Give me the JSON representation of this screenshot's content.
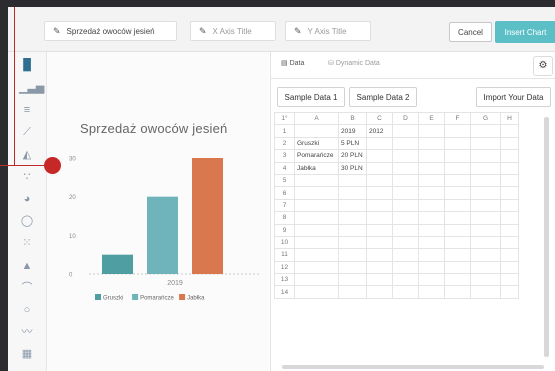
{
  "toolbar": {
    "chart_title_value": "Sprzedaż owoców jesień",
    "x_axis_placeholder": "X Axis Title",
    "y_axis_placeholder": "Y Axis Title",
    "cancel_label": "Cancel",
    "insert_label": "Insert Chart"
  },
  "rail": {
    "icons": [
      "bar-chart-icon",
      "column-chart-icon",
      "stacked-bar-icon",
      "line-chart-icon",
      "area-chart-icon",
      "scatter-icon",
      "pie-chart-icon",
      "donut-chart-icon",
      "heatmap-icon",
      "mountain-icon",
      "arc-icon",
      "circle-icon",
      "sparkline-icon",
      "table-icon"
    ]
  },
  "panel": {
    "tab_data": "Data",
    "tab_dynamic": "Dynamic Data",
    "sample1": "Sample Data 1",
    "sample2": "Sample Data 2",
    "import": "Import Your Data"
  },
  "sheet": {
    "corner": "1°",
    "columns": [
      "A",
      "B",
      "C",
      "D",
      "E",
      "F",
      "G",
      "H"
    ],
    "rows": [
      [
        "1",
        "",
        "2019",
        "2012",
        "",
        "",
        "",
        "",
        ""
      ],
      [
        "2",
        "Gruszki",
        "5 PLN",
        "",
        "",
        "",
        "",
        "",
        ""
      ],
      [
        "3",
        "Pomarańcze",
        "20 PLN",
        "",
        "",
        "",
        "",
        "",
        ""
      ],
      [
        "4",
        "Jabłka",
        "30 PLN",
        "",
        "",
        "",
        "",
        "",
        ""
      ],
      [
        "5",
        "",
        "",
        "",
        "",
        "",
        "",
        "",
        ""
      ],
      [
        "6",
        "",
        "",
        "",
        "",
        "",
        "",
        "",
        ""
      ],
      [
        "7",
        "",
        "",
        "",
        "",
        "",
        "",
        "",
        ""
      ],
      [
        "8",
        "",
        "",
        "",
        "",
        "",
        "",
        "",
        ""
      ],
      [
        "9",
        "",
        "",
        "",
        "",
        "",
        "",
        "",
        ""
      ],
      [
        "10",
        "",
        "",
        "",
        "",
        "",
        "",
        "",
        ""
      ],
      [
        "11",
        "",
        "",
        "",
        "",
        "",
        "",
        "",
        ""
      ],
      [
        "12",
        "",
        "",
        "",
        "",
        "",
        "",
        "",
        ""
      ],
      [
        "13",
        "",
        "",
        "",
        "",
        "",
        "",
        "",
        ""
      ],
      [
        "14",
        "",
        "",
        "",
        "",
        "",
        "",
        "",
        ""
      ]
    ]
  },
  "colors": {
    "gruszki": "#4e9ea2",
    "pomarancze": "#6fb4bb",
    "jablka": "#d9774f",
    "accent": "#5cbfc6",
    "callout": "#c62828"
  },
  "chart_data": {
    "type": "bar",
    "title": "Sprzedaż owoców jesień",
    "categories": [
      "2019"
    ],
    "series": [
      {
        "name": "Gruszki",
        "values": [
          5
        ]
      },
      {
        "name": "Pomarańcze",
        "values": [
          20
        ]
      },
      {
        "name": "Jabłka",
        "values": [
          30
        ]
      }
    ],
    "yticks": [
      "0",
      "10",
      "20",
      "30"
    ],
    "ylim": [
      0,
      30
    ],
    "grid": false,
    "legend": "bottom"
  }
}
